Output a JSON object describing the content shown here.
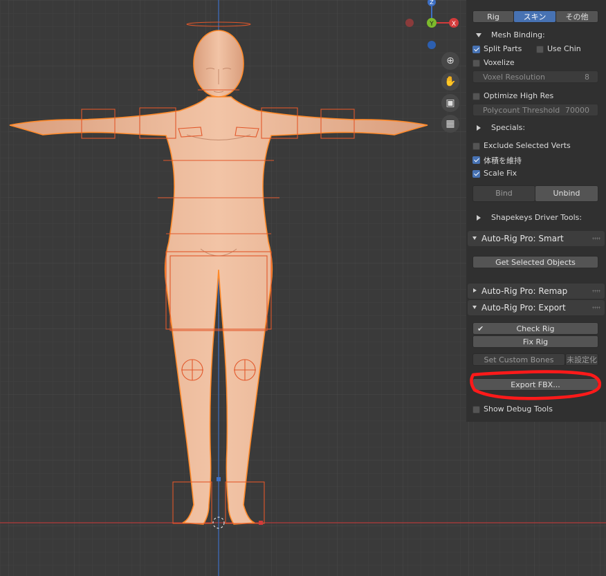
{
  "gizmo": {
    "z": "Z",
    "y": "Y",
    "x": "X"
  },
  "nav_icons": [
    "zoom-icon",
    "hand-pan-icon",
    "camera-icon",
    "grid-icon"
  ],
  "panel": {
    "tabs": [
      "Rig",
      "スキン",
      "その他"
    ],
    "active_tab": "スキン",
    "mesh_binding": "Mesh Binding:",
    "split_parts": "Split Parts",
    "use_chin": "Use Chin",
    "voxelize": "Voxelize",
    "voxel_resolution": {
      "label": "Voxel Resolution",
      "value": "8"
    },
    "optimize_high_res": "Optimize High Res",
    "polycount_threshold": {
      "label": "Polycount Threshold",
      "value": "70000"
    },
    "specials": "Specials:",
    "exclude_selected_verts": "Exclude Selected Verts",
    "preserve_volume": "体積を維持",
    "scale_fix": "Scale Fix",
    "bind": "Bind",
    "unbind": "Unbind",
    "shapekeys_driver_tools": "Shapekeys Driver Tools:",
    "smart_header": "Auto-Rig Pro: Smart",
    "get_selected_objects": "Get Selected Objects",
    "remap_header": "Auto-Rig Pro: Remap",
    "export_header": "Auto-Rig Pro: Export",
    "check_rig": "Check Rig",
    "fix_rig": "Fix Rig",
    "set_custom_bones": "Set Custom Bones",
    "unset": "未設定化",
    "export_fbx": "Export FBX...",
    "show_debug_tools": "Show Debug Tools"
  }
}
